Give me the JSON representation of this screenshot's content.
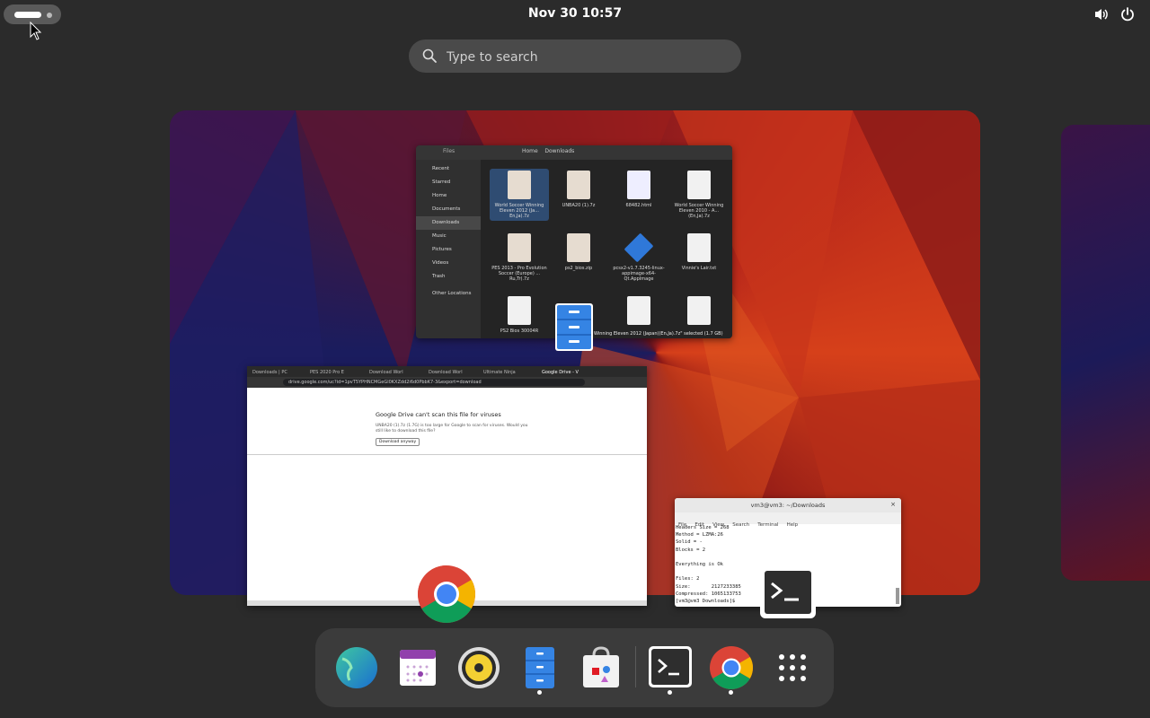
{
  "topbar": {
    "clock": "Nov 30  10:57"
  },
  "search": {
    "placeholder": "Type to search"
  },
  "files_window": {
    "title": "Files",
    "path": "Downloads",
    "path_home": "Home",
    "sidebar": [
      {
        "label": "Recent"
      },
      {
        "label": "Starred"
      },
      {
        "label": "Home"
      },
      {
        "label": "Documents"
      },
      {
        "label": "Downloads"
      },
      {
        "label": "Music"
      },
      {
        "label": "Pictures"
      },
      {
        "label": "Videos"
      },
      {
        "label": "Trash"
      },
      {
        "label": "Other Locations"
      }
    ],
    "files": [
      {
        "name": "World Soccer Winning Eleven 2012 (Ja... En,Ja).7z"
      },
      {
        "name": "UNBA20 (1).7z"
      },
      {
        "name": "68482.html"
      },
      {
        "name": "World Soccer Winning Eleven 2010 - A... (En,Ja).7z"
      },
      {
        "name": "PES 2013 - Pro Evolution Soccer (Europe) ... Ru,Tr).7z"
      },
      {
        "name": "ps2_bios.zip"
      },
      {
        "name": "pcsx2-v1.7.3245-linux-appimage-x64-Qt.AppImage"
      },
      {
        "name": "Vinnie's Lair.txt"
      },
      {
        "name": "PS2 Bios 30004R"
      },
      {
        "name": ""
      },
      {
        "name": ""
      },
      {
        "name": ""
      }
    ],
    "status": "Winning Eleven 2012 (Japan)(En,Ja).7z\" selected (1.7 GB)"
  },
  "chrome_window": {
    "tabs": [
      {
        "label": "Downloads | PC"
      },
      {
        "label": "PES 2020 Pro E"
      },
      {
        "label": "Download Worl"
      },
      {
        "label": "Download Worl"
      },
      {
        "label": "Ultimate Ninja"
      },
      {
        "label": "Google Drive - V"
      }
    ],
    "url": "drive.google.com/uc?id=1pvT5YPHNCMGeGl0KXZdd2i6d0PbbK7-3&export=download",
    "heading": "Google Drive can't scan this file for viruses",
    "text": "UNBA20 (1).7z (1.7G) is too large for Google to scan for viruses. Would you still like to download this file?",
    "button": "Download anyway"
  },
  "terminal_window": {
    "title": "vm3@vm3: ~/Downloads",
    "menu": [
      "File",
      "Edit",
      "View",
      "Search",
      "Terminal",
      "Help"
    ],
    "lines": [
      "Headers Size = 268",
      "Method = LZMA:26",
      "Solid = -",
      "Blocks = 2",
      "",
      "Everything is Ok",
      "",
      "Files: 2",
      "Size:       2127233385",
      "Compressed: 1065133753",
      "[vm3@vm3 Downloads]$ "
    ]
  },
  "dash": {
    "items": [
      {
        "name": "web-browser"
      },
      {
        "name": "calendar"
      },
      {
        "name": "rhythmbox"
      },
      {
        "name": "files",
        "running": true
      },
      {
        "name": "software"
      },
      {
        "name": "terminal",
        "running": true
      },
      {
        "name": "google-chrome",
        "running": true
      },
      {
        "name": "show-apps"
      }
    ]
  },
  "colors": {
    "panel": "#2b2b2b",
    "dash": "#3b3b3b",
    "search": "#4a4a4a"
  }
}
